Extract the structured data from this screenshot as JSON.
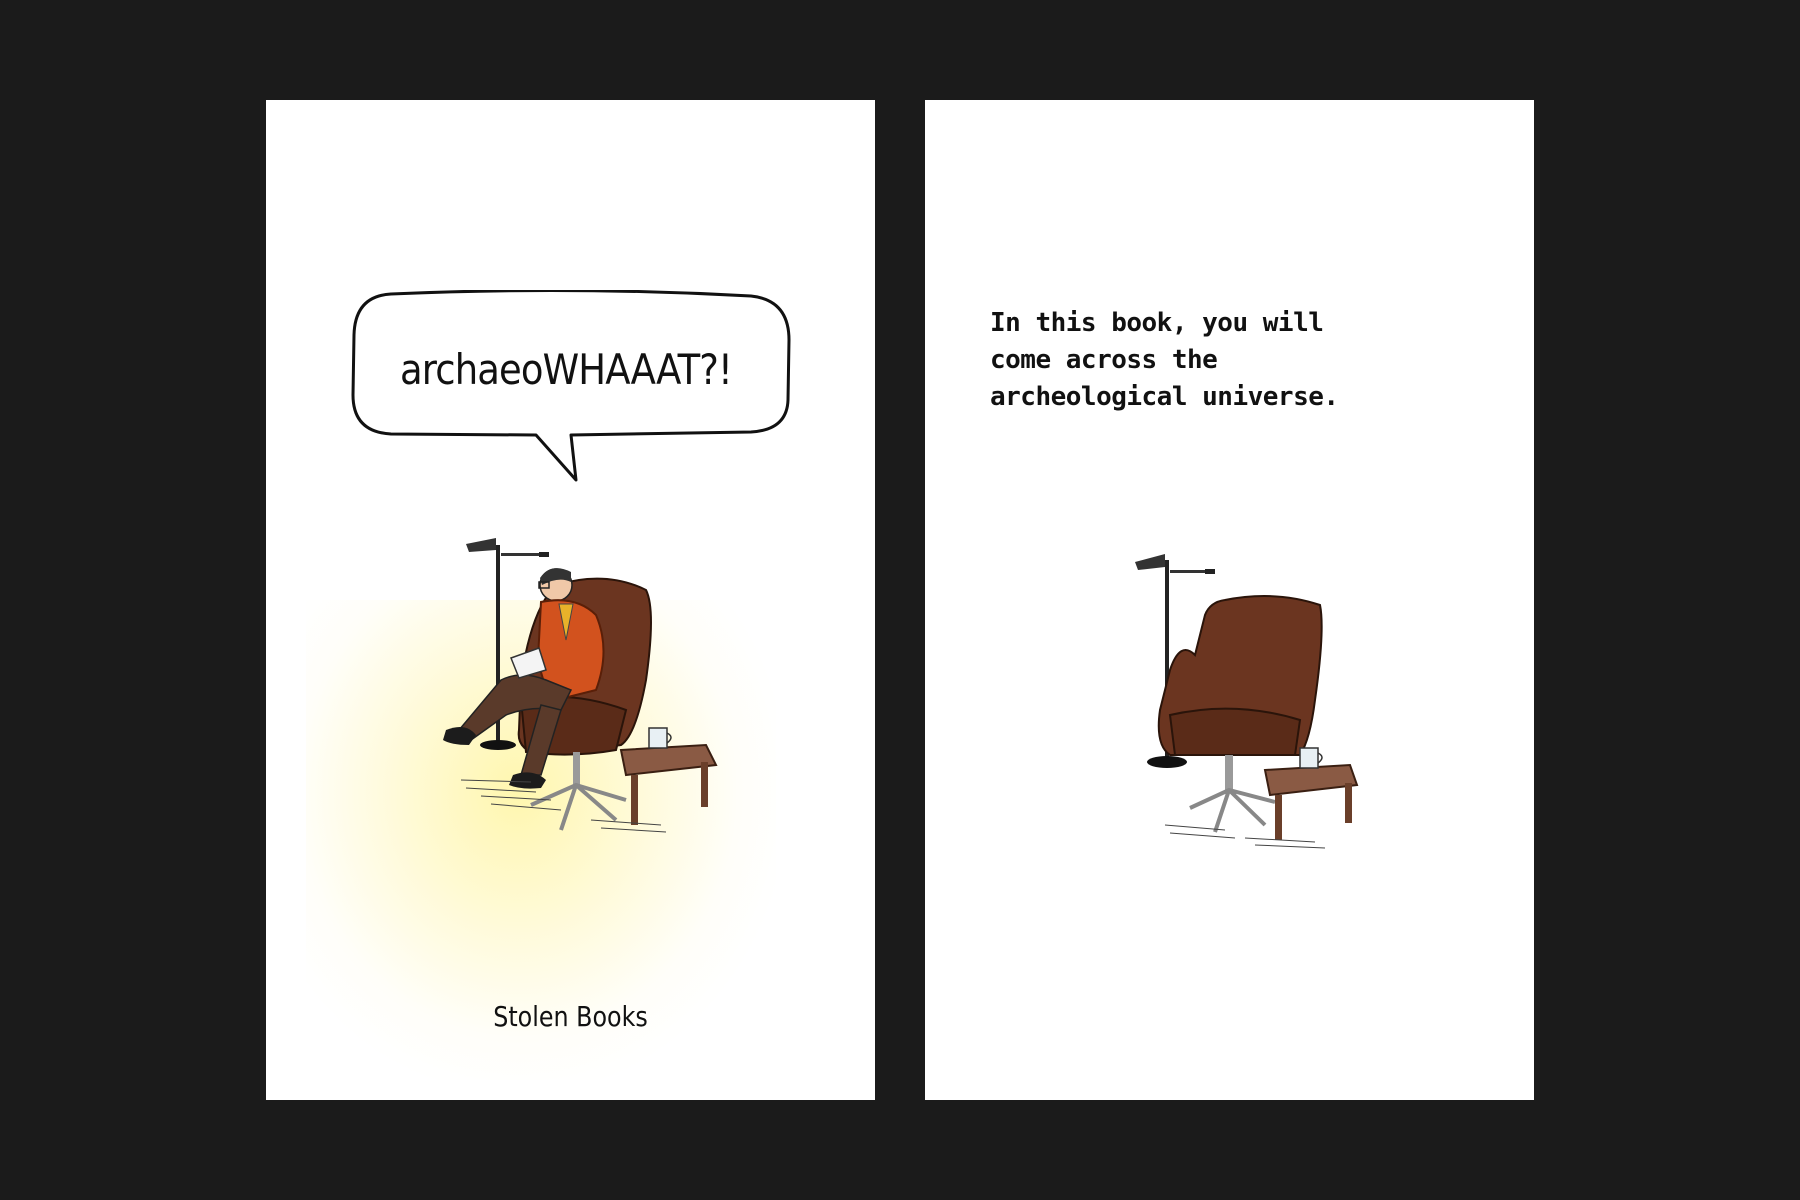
{
  "cover": {
    "speech": "archaeoWHAAAT?!",
    "publisher": "Stolen Books"
  },
  "intro": {
    "lines": [
      "In this book, you will",
      "come across the",
      "archeological universe."
    ]
  },
  "colors": {
    "background": "#1b1b1b",
    "page": "#ffffff",
    "chair": "#5a2f1c",
    "sweater": "#d2521e",
    "glow": "#fff6aa"
  },
  "icons": [
    "speech-bubble",
    "floor-lamp",
    "armchair",
    "side-table",
    "mug"
  ]
}
